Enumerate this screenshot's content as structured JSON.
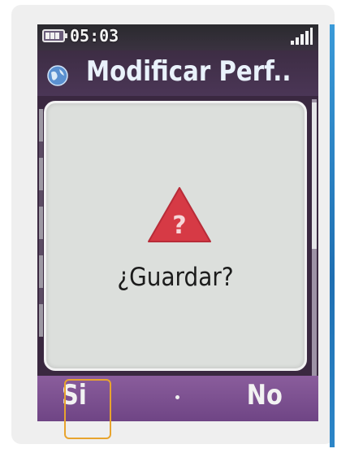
{
  "status_bar": {
    "time": "05:03",
    "battery_icon": "battery-icon",
    "signal_icon": "signal-bars-icon"
  },
  "header": {
    "title": "Modificar Perf..",
    "icon": "globe-icon"
  },
  "dialog": {
    "icon": "warning-question-icon",
    "message": "¿Guardar?"
  },
  "softkeys": {
    "left": "Si",
    "right": "No"
  },
  "colors": {
    "title_text": "#e9f2fb",
    "softkey_bar": "#7a4e8f",
    "warning_triangle": "#d63a45",
    "highlight": "#e8a42e"
  }
}
